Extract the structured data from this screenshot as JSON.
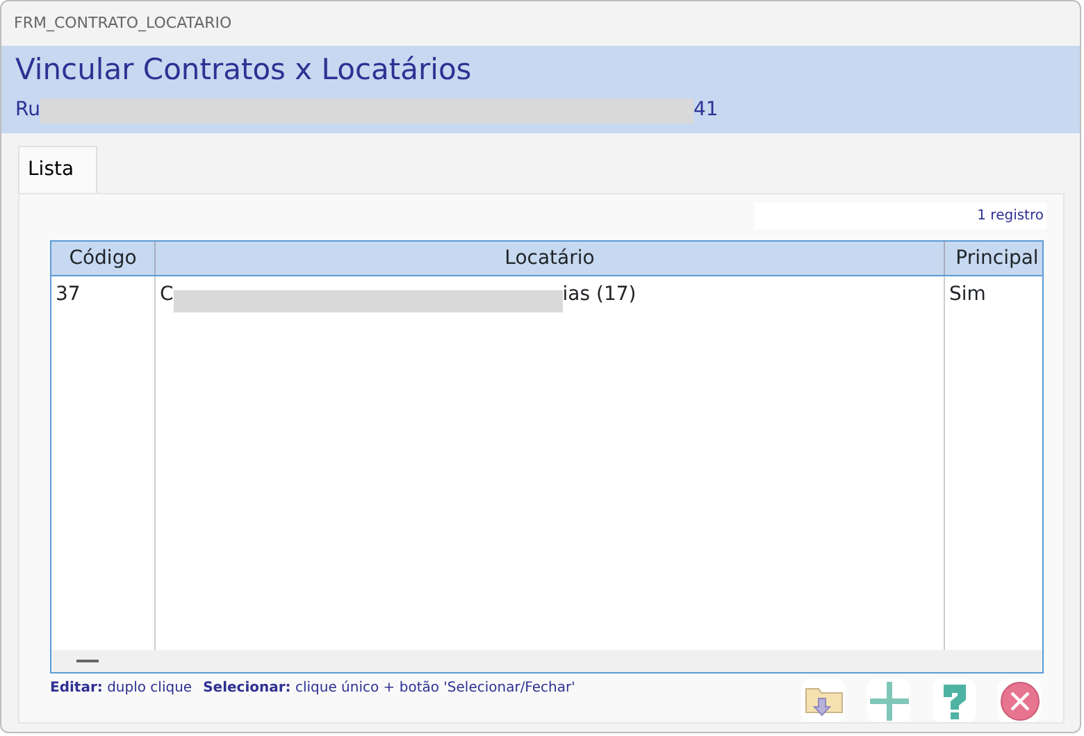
{
  "window": {
    "title": "FRM_CONTRATO_LOCATARIO"
  },
  "header": {
    "title": "Vincular Contratos x Locatários",
    "subtitle": {
      "start": "Ru",
      "end": "41",
      "redacted": true
    }
  },
  "tabs": [
    {
      "label": "Lista",
      "selected": true
    }
  ],
  "record_count": "1 registro",
  "table": {
    "columns": [
      "Código",
      "Locatário",
      "Principal"
    ],
    "rows": [
      {
        "cells": [
          {
            "text": "37"
          },
          {
            "start": "C",
            "end": "ias (17)",
            "redacted": true
          },
          {
            "text": "Sim"
          }
        ]
      }
    ]
  },
  "hints": [
    {
      "label": "Editar:",
      "text": "duplo clique"
    },
    {
      "label": "Selecionar:",
      "text": "clique único + botão 'Selecionar/Fechar'"
    }
  ],
  "buttons": [
    {
      "kind": "folder"
    },
    {
      "kind": "add"
    },
    {
      "kind": "help"
    },
    {
      "kind": "close"
    }
  ]
}
